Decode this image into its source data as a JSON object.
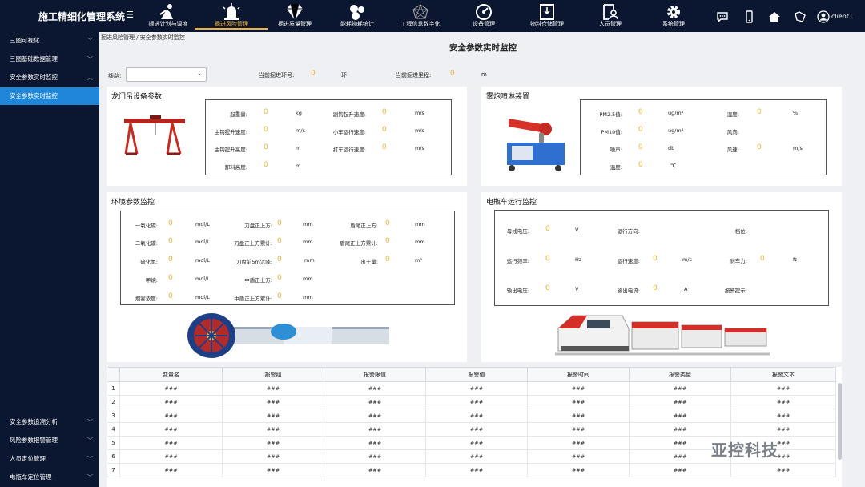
{
  "app": {
    "title": "施工精细化管理系统",
    "menu_icon": "hamburger-icon",
    "user": "client1"
  },
  "nav": [
    {
      "label": "掘进计划与调度",
      "icon": "worker-icon"
    },
    {
      "label": "掘进风险管理",
      "icon": "alarm-light-icon",
      "active": true
    },
    {
      "label": "掘进质量管理",
      "icon": "diamond-icon"
    },
    {
      "label": "能耗物耗统计",
      "icon": "pills-icon"
    },
    {
      "label": "工程信息数字化",
      "icon": "network-icon"
    },
    {
      "label": "设备管理",
      "icon": "gauge-icon"
    },
    {
      "label": "物料仓储管理",
      "icon": "warehouse-icon"
    },
    {
      "label": "人员管理",
      "icon": "person-card-icon"
    },
    {
      "label": "系统管理",
      "icon": "gear-icon"
    }
  ],
  "sidebar": {
    "top_items": [
      {
        "label": "三图可视化"
      },
      {
        "label": "三图基础数据管理"
      },
      {
        "label": "安全参数实时监控",
        "expanded": true
      },
      {
        "label": "安全参数实时监控",
        "active": true
      }
    ],
    "bottom_items": [
      {
        "label": "安全参数追溯分析"
      },
      {
        "label": "风险参数报警管理"
      },
      {
        "label": "人员定位管理"
      },
      {
        "label": "电瓶车定位管理"
      }
    ]
  },
  "breadcrumb": "掘进风险管理 / 安全参数实时监控",
  "page_title": "安全参数实时监控",
  "filter": {
    "line_label": "线路:",
    "ring_label": "当前掘进环号:",
    "ring_value": "0",
    "ring_unit": "环",
    "mileage_label": "当前掘进里程:",
    "mileage_value": "0",
    "mileage_unit": "m"
  },
  "gantry": {
    "title": "龙门吊设备参数",
    "rows": [
      {
        "label": "起重量:",
        "value": "0",
        "unit": "kg"
      },
      {
        "label": "主钩提升速度:",
        "value": "0",
        "unit": "m/s"
      },
      {
        "label": "主钩提升高度:",
        "value": "0",
        "unit": "m"
      },
      {
        "label": "卸料高度:",
        "value": "0",
        "unit": "m"
      },
      {
        "label": "副钩起升速度:",
        "value": "0",
        "unit": "m/s"
      },
      {
        "label": "小车运行速度:",
        "value": "0",
        "unit": "m/s"
      },
      {
        "label": "打车运行速度:",
        "value": "0",
        "unit": "m/s"
      }
    ]
  },
  "spray": {
    "title": "雾炮喷淋装置",
    "rows": [
      {
        "label": "PM2.5值:",
        "value": "0",
        "unit": "ug/m³"
      },
      {
        "label": "PM10值:",
        "value": "0",
        "unit": "ug/m³"
      },
      {
        "label": "噪声:",
        "value": "0",
        "unit": "db"
      },
      {
        "label": "温度:",
        "value": "0",
        "unit": "℃"
      },
      {
        "label": "湿度:",
        "value": "0",
        "unit": "%"
      },
      {
        "label": "风向:",
        "value": "",
        "unit": ""
      },
      {
        "label": "风速:",
        "value": "0",
        "unit": "m/s"
      }
    ]
  },
  "env": {
    "title": "环境参数监控",
    "rows": [
      {
        "label": "一氧化碳:",
        "value": "0",
        "unit": "mol/L"
      },
      {
        "label": "二氧化碳:",
        "value": "0",
        "unit": "mol/L"
      },
      {
        "label": "硫化氢:",
        "value": "0",
        "unit": "mol/L"
      },
      {
        "label": "甲烷:",
        "value": "0",
        "unit": "mol/L"
      },
      {
        "label": "烟雾浓度:",
        "value": "0",
        "unit": "mol/L"
      },
      {
        "label": "刀盘正上方:",
        "value": "0",
        "unit": "mm"
      },
      {
        "label": "刀盘正上方累计:",
        "value": "0",
        "unit": "mm"
      },
      {
        "label": "刀盘前5m沉降:",
        "value": "0",
        "unit": "mm"
      },
      {
        "label": "中盾正上方:",
        "value": "0",
        "unit": "mm"
      },
      {
        "label": "中盾正上方累计:",
        "value": "0",
        "unit": "mm"
      },
      {
        "label": "盾尾正上方:",
        "value": "0",
        "unit": "mm"
      },
      {
        "label": "盾尾正上方累计:",
        "value": "0",
        "unit": "mm"
      },
      {
        "label": "出土量:",
        "value": "0",
        "unit": "m³"
      }
    ]
  },
  "car": {
    "title": "电瓶车运行监控",
    "rows": [
      {
        "label": "母线电压:",
        "value": "0",
        "unit": "V"
      },
      {
        "label": "运行频率:",
        "value": "0",
        "unit": "Hz"
      },
      {
        "label": "输出电压:",
        "value": "0",
        "unit": "V"
      },
      {
        "label": "运行方向:",
        "value": "",
        "unit": ""
      },
      {
        "label": "运行速度:",
        "value": "0",
        "unit": "m/s"
      },
      {
        "label": "输出电流:",
        "value": "0",
        "unit": "A"
      },
      {
        "label": "档位:",
        "value": "",
        "unit": ""
      },
      {
        "label": "刹车力:",
        "value": "0",
        "unit": "N"
      },
      {
        "label": "报警提示:",
        "value": "",
        "unit": ""
      }
    ]
  },
  "alarm_table": {
    "columns": [
      "变量名",
      "报警组",
      "报警限值",
      "报警值",
      "报警时间",
      "报警类型",
      "报警文本"
    ],
    "rows": [
      {
        "idx": "1",
        "cells": [
          "###",
          "###",
          "###",
          "###",
          "###",
          "###",
          "###"
        ]
      },
      {
        "idx": "2",
        "cells": [
          "###",
          "###",
          "###",
          "###",
          "###",
          "###",
          "###"
        ]
      },
      {
        "idx": "3",
        "cells": [
          "###",
          "###",
          "###",
          "###",
          "###",
          "###",
          "###"
        ]
      },
      {
        "idx": "4",
        "cells": [
          "###",
          "###",
          "###",
          "###",
          "###",
          "###",
          "###"
        ]
      },
      {
        "idx": "5",
        "cells": [
          "###",
          "###",
          "###",
          "###",
          "###",
          "###",
          "###"
        ]
      },
      {
        "idx": "6",
        "cells": [
          "###",
          "###",
          "###",
          "###",
          "###",
          "###",
          "###"
        ]
      },
      {
        "idx": "7",
        "cells": [
          "###",
          "###",
          "###",
          "###",
          "###",
          "###",
          "###"
        ]
      }
    ]
  },
  "watermark": "亚控科技",
  "colors": {
    "nav_bg": "#0b1730",
    "active_blue": "#1f86d9",
    "value_orange": "#f2b233"
  }
}
